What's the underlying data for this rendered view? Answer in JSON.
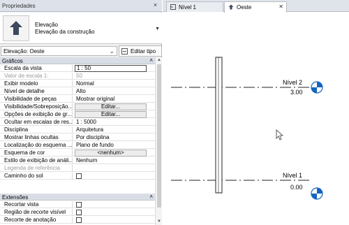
{
  "properties": {
    "title": "Propriedades",
    "close": "×",
    "type_selector": {
      "family": "Elevação",
      "type": "Elevação da construção",
      "icon": "elevation-marker-icon"
    },
    "instance_filter": "Elevação: Oeste",
    "edit_type": "Editar tipo",
    "sections": {
      "graphics": "Gráficos",
      "extents": "Extensões"
    },
    "rows": [
      {
        "name": "Escala da vista",
        "value": "1 : 50"
      },
      {
        "name": "Valor de escala    1:",
        "value": "50"
      },
      {
        "name": "Exibir modelo",
        "value": "Normal"
      },
      {
        "name": "Nível de detalhe",
        "value": "Alto"
      },
      {
        "name": "Visibilidade de peças",
        "value": "Mostrar original"
      },
      {
        "name": "Visibilidade/Sobreposição...",
        "value": "Editar..."
      },
      {
        "name": "Opções de exibição de gr...",
        "value": "Editar..."
      },
      {
        "name": "Ocultar em escalas de res...",
        "value": "1 : 5000"
      },
      {
        "name": "Disciplina",
        "value": "Arquitetura"
      },
      {
        "name": "Mostrar linhas ocultas",
        "value": "Por disciplina"
      },
      {
        "name": "Localização do esquema ...",
        "value": "Plano de fundo"
      },
      {
        "name": "Esquema de cor",
        "value": "<nenhum>"
      },
      {
        "name": "Estilo de exibição de análi...",
        "value": "Nenhum"
      },
      {
        "name": "Legenda de referência",
        "value": ""
      },
      {
        "name": "Caminho do sol",
        "value": ""
      }
    ],
    "extent_rows": [
      {
        "name": "Recortar vista"
      },
      {
        "name": "Região de recorte visível"
      },
      {
        "name": "Recorte de anotação"
      }
    ]
  },
  "tabs": [
    {
      "label": "Nível 1",
      "icon": "floor-plan-icon",
      "active": false
    },
    {
      "label": "Oeste",
      "icon": "elevation-view-icon",
      "active": true
    }
  ],
  "view": {
    "levels": [
      {
        "name": "Nível 2",
        "elevation": "3.00"
      },
      {
        "name": "Nível 1",
        "elevation": "0.00"
      }
    ]
  },
  "colors": {
    "level_marker": "#1565c0",
    "panel_bg": "#f0f0f0",
    "title_bg": "#dde2ea"
  }
}
